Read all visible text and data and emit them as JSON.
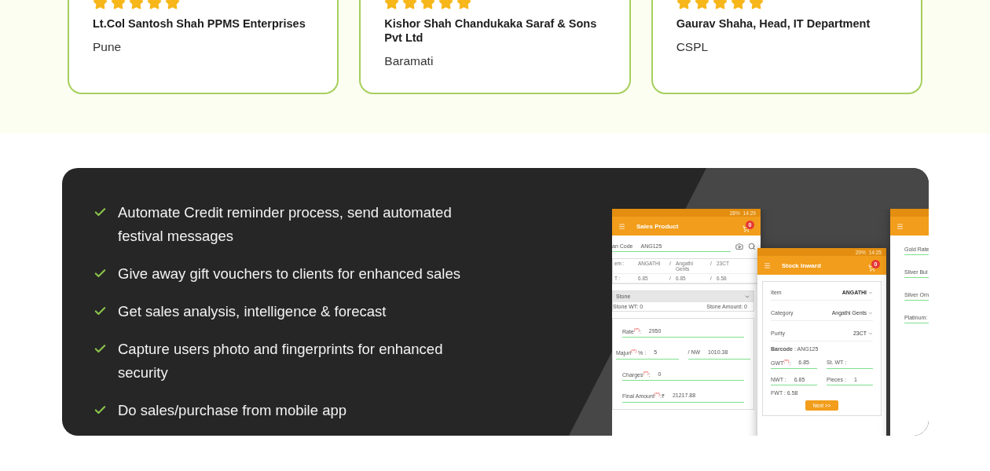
{
  "testimonials": [
    {
      "name": "Lt.Col Santosh Shah PPMS Enterprises",
      "place": "Pune",
      "stars": 5
    },
    {
      "name": "Kishor Shah Chandukaka Saraf & Sons Pvt Ltd",
      "place": "Baramati",
      "stars": 5
    },
    {
      "name": "Gaurav Shaha, Head, IT Department",
      "place": "CSPL",
      "stars": 5
    }
  ],
  "features": [
    "Automate Credit reminder process, send automated festival messages",
    "Give away gift vouchers to clients for enhanced sales",
    "Get sales analysis, intelligence & forecast",
    "Capture users photo and fingerprints for enhanced security",
    "Do sales/purchase from mobile app"
  ],
  "app_screens": [
    {
      "kind": "sales",
      "title": "Sales Product",
      "badge": "0",
      "battery": "28%",
      "time": "14:29",
      "scan": {
        "label": "an Code",
        "value": "ANG125"
      },
      "table": [
        [
          "em :",
          "ANGATHI",
          "/",
          "Angathi Gents",
          "/",
          "23CT"
        ],
        [
          "T :",
          "6.85",
          "/",
          "6.85",
          "/",
          "6.58"
        ]
      ],
      "stone": {
        "title": "Stone",
        "weight": "Stone WT: 0",
        "amount": "Stone Amount: 0"
      },
      "fields": [
        {
          "kind": "single",
          "label": "Rate$^{(**)}$:",
          "value": "2950"
        },
        {
          "kind": "pair",
          "label": "Majuri$^{(**)}$ % :",
          "value": "5",
          "label2": "/ NW",
          "value2": "1010.38"
        },
        {
          "kind": "single",
          "label": "Charges$^{(**)}$:",
          "value": "0"
        },
        {
          "kind": "single",
          "label": "Final Amount$^{(**)}$:₹",
          "value": "21217.88"
        }
      ]
    },
    {
      "kind": "inward",
      "title": "Stock Inward",
      "badge": "0",
      "battery": "29%",
      "time": "14:25",
      "selects": [
        {
          "label": "Item",
          "value": "ANGATHI"
        },
        {
          "label": "Category",
          "value": "Angathi Gents"
        },
        {
          "label": "Purity",
          "value": "23CT"
        }
      ],
      "barcode": "**Barcode** : ANG125",
      "fields": [
        {
          "kind": "pair",
          "label": "GWT$^{(**)}$:",
          "value": "6.85",
          "label2": "St. WT :"
        },
        {
          "kind": "pair",
          "label": "NWT :",
          "value": "6.85",
          "label2": "Pieces :",
          "value2": "1"
        },
        {
          "kind": "plain",
          "label": "FWT : 6.58"
        }
      ],
      "button": "Next >>"
    },
    {
      "kind": "rates",
      "labels": [
        "Gold Rate",
        "Silver Bul",
        "Silver Orn",
        "Platinum:"
      ]
    }
  ]
}
